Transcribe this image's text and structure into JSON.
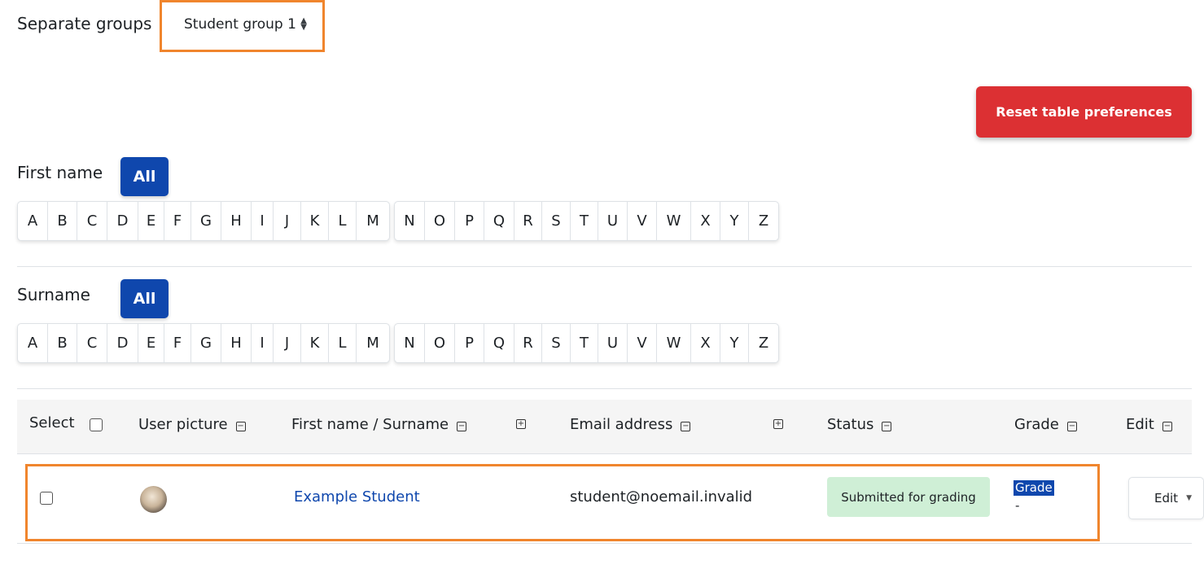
{
  "groups": {
    "label": "Separate groups",
    "selected": "Student group 1"
  },
  "reset_button": "Reset table preferences",
  "firstname_filter": {
    "label": "First name",
    "all": "All",
    "letters_a_m": [
      "A",
      "B",
      "C",
      "D",
      "E",
      "F",
      "G",
      "H",
      "I",
      "J",
      "K",
      "L",
      "M"
    ],
    "letters_n_z": [
      "N",
      "O",
      "P",
      "Q",
      "R",
      "S",
      "T",
      "U",
      "V",
      "W",
      "X",
      "Y",
      "Z"
    ]
  },
  "surname_filter": {
    "label": "Surname",
    "all": "All",
    "letters_a_m": [
      "A",
      "B",
      "C",
      "D",
      "E",
      "F",
      "G",
      "H",
      "I",
      "J",
      "K",
      "L",
      "M"
    ],
    "letters_n_z": [
      "N",
      "O",
      "P",
      "Q",
      "R",
      "S",
      "T",
      "U",
      "V",
      "W",
      "X",
      "Y",
      "Z"
    ]
  },
  "table": {
    "headers": {
      "select": "Select",
      "user_picture": "User picture",
      "fullname": "First name / Surname",
      "email": "Email address",
      "status": "Status",
      "grade": "Grade",
      "edit": "Edit"
    },
    "collapse_glyph": "−",
    "expand_glyph": "+",
    "rows": [
      {
        "name": "Example Student",
        "email": "student@noemail.invalid",
        "status": "Submitted for grading",
        "grade_label": "Grade",
        "grade_value": "-",
        "edit": "Edit"
      }
    ]
  },
  "colors": {
    "primary": "#0f47ad",
    "danger": "#dc3033",
    "highlight": "#f0852d",
    "status_bg": "#cfefd6"
  }
}
